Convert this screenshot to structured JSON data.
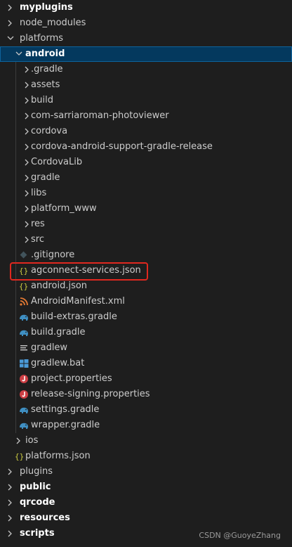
{
  "explorer": {
    "items": [
      {
        "label": "myplugins",
        "type": "folder",
        "depth": 0,
        "bold": true,
        "expanded": false
      },
      {
        "label": "node_modules",
        "type": "folder",
        "depth": 0,
        "bold": false,
        "expanded": false
      },
      {
        "label": "platforms",
        "type": "folder",
        "depth": 0,
        "bold": false,
        "expanded": true
      },
      {
        "label": "android",
        "type": "folder",
        "depth": 1,
        "bold": true,
        "expanded": true,
        "selected": true
      },
      {
        "label": ".gradle",
        "type": "folder",
        "depth": 2
      },
      {
        "label": "assets",
        "type": "folder",
        "depth": 2
      },
      {
        "label": "build",
        "type": "folder",
        "depth": 2
      },
      {
        "label": "com-sarriaroman-photoviewer",
        "type": "folder",
        "depth": 2
      },
      {
        "label": "cordova",
        "type": "folder",
        "depth": 2
      },
      {
        "label": "cordova-android-support-gradle-release",
        "type": "folder",
        "depth": 2
      },
      {
        "label": "CordovaLib",
        "type": "folder",
        "depth": 2
      },
      {
        "label": "gradle",
        "type": "folder",
        "depth": 2
      },
      {
        "label": "libs",
        "type": "folder",
        "depth": 2
      },
      {
        "label": "platform_www",
        "type": "folder",
        "depth": 2
      },
      {
        "label": "res",
        "type": "folder",
        "depth": 2
      },
      {
        "label": "src",
        "type": "folder",
        "depth": 2
      },
      {
        "label": ".gitignore",
        "type": "file",
        "icon": "git-icon",
        "depth": 2
      },
      {
        "label": "agconnect-services.json",
        "type": "file",
        "icon": "json-icon",
        "depth": 2,
        "highlighted": true
      },
      {
        "label": "android.json",
        "type": "file",
        "icon": "json-icon",
        "depth": 2
      },
      {
        "label": "AndroidManifest.xml",
        "type": "file",
        "icon": "rss-xml-icon",
        "depth": 2
      },
      {
        "label": "build-extras.gradle",
        "type": "file",
        "icon": "gradle-elephant-icon",
        "depth": 2
      },
      {
        "label": "build.gradle",
        "type": "file",
        "icon": "gradle-elephant-icon",
        "depth": 2
      },
      {
        "label": "gradlew",
        "type": "file",
        "icon": "lines-file-icon",
        "depth": 2
      },
      {
        "label": "gradlew.bat",
        "type": "file",
        "icon": "windows-icon",
        "depth": 2
      },
      {
        "label": "project.properties",
        "type": "file",
        "icon": "java-properties-icon",
        "depth": 2
      },
      {
        "label": "release-signing.properties",
        "type": "file",
        "icon": "java-properties-icon",
        "depth": 2
      },
      {
        "label": "settings.gradle",
        "type": "file",
        "icon": "gradle-elephant-icon",
        "depth": 2
      },
      {
        "label": "wrapper.gradle",
        "type": "file",
        "icon": "gradle-elephant-icon",
        "depth": 2
      },
      {
        "label": "ios",
        "type": "folder",
        "depth": 1,
        "expanded": false
      },
      {
        "label": "platforms.json",
        "type": "file",
        "icon": "json-icon",
        "depth": 1
      },
      {
        "label": "plugins",
        "type": "folder",
        "depth": 0
      },
      {
        "label": "public",
        "type": "folder",
        "depth": 0,
        "bold": true
      },
      {
        "label": "qrcode",
        "type": "folder",
        "depth": 0,
        "bold": true
      },
      {
        "label": "resources",
        "type": "folder",
        "depth": 0,
        "bold": true
      },
      {
        "label": "scripts",
        "type": "folder",
        "depth": 0,
        "bold": true
      }
    ]
  },
  "watermark": "CSDN @GuoyeZhang",
  "colors": {
    "background": "#1e1e1e",
    "selection": "#04395e",
    "selection_border": "#0e639c",
    "highlight_box": "#e0281f",
    "json": "#cbcb41",
    "gradle": "#3f8fc2",
    "xml_rss": "#e37933",
    "java_properties": "#cc3e44",
    "windows": "#4a9ad8"
  }
}
